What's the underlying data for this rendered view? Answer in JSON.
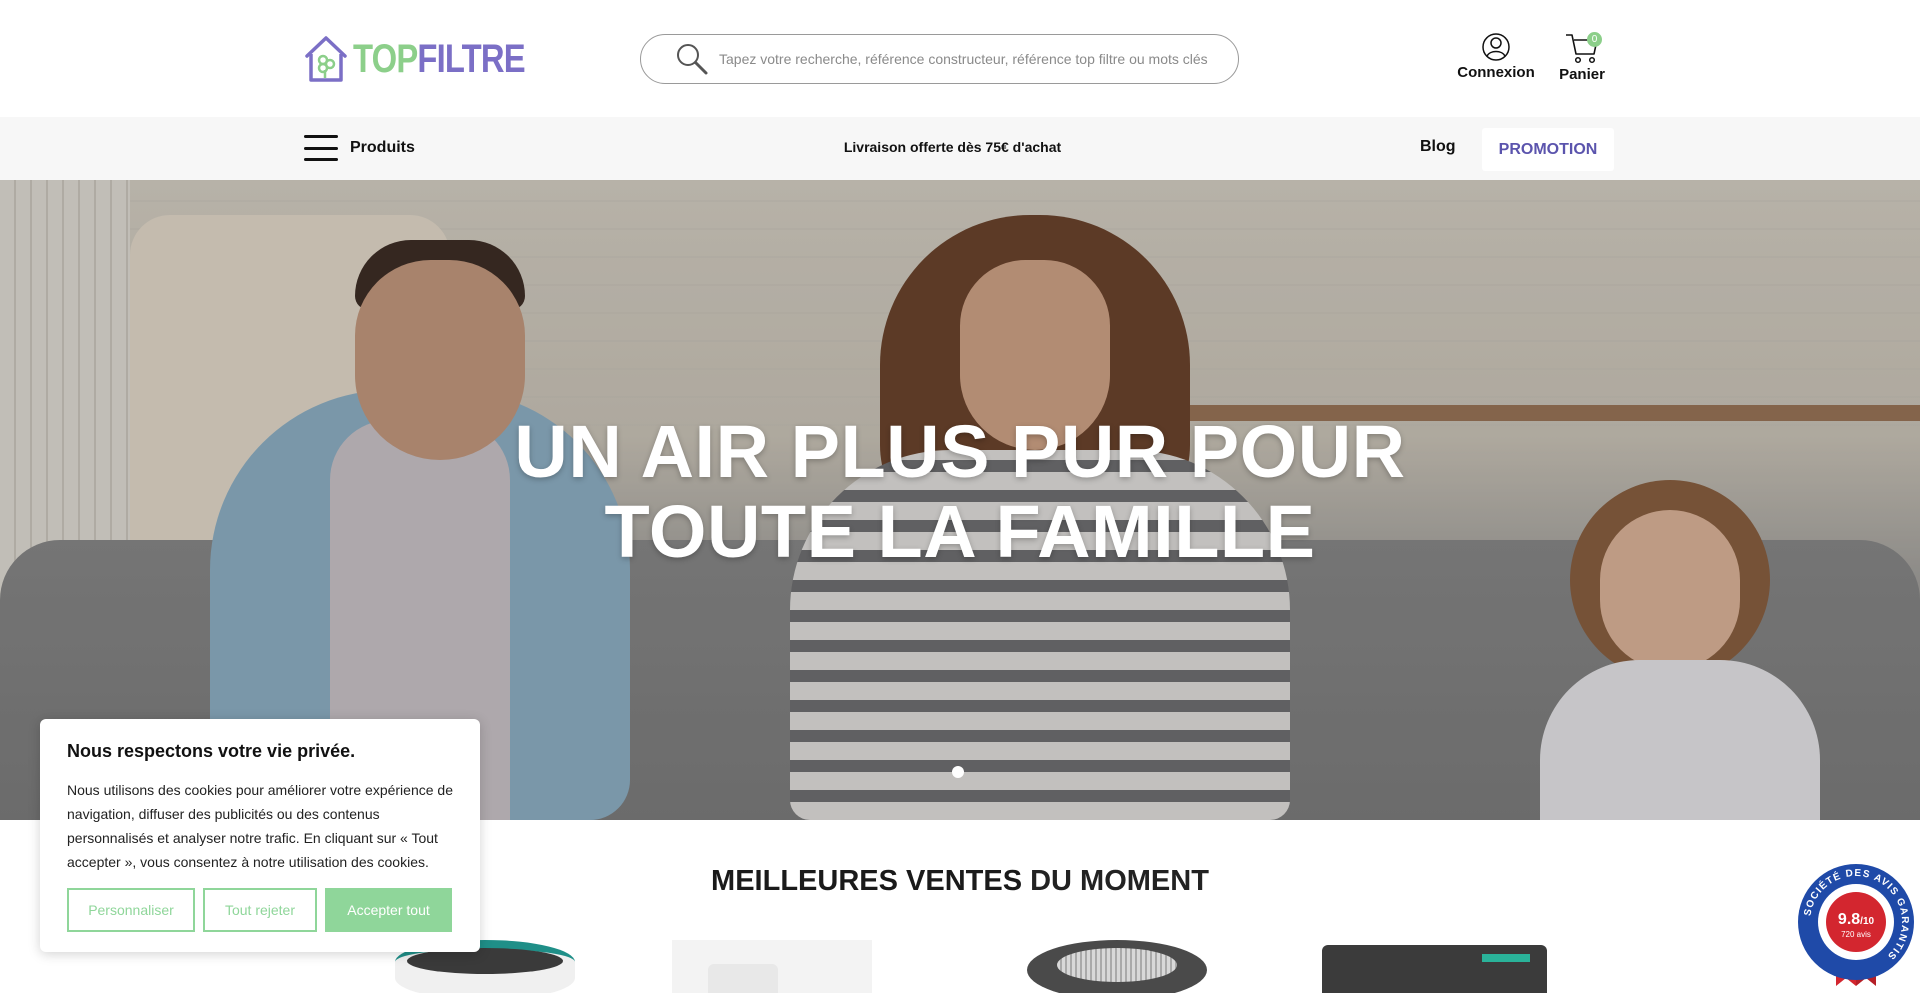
{
  "header": {
    "logo": {
      "part1": "TOP",
      "part2": "FILTRE"
    },
    "search": {
      "placeholder": "Tapez votre recherche, référence constructeur, référence top filtre ou mots clés"
    },
    "account_label": "Connexion",
    "cart_label": "Panier",
    "cart_count": "0"
  },
  "navbar": {
    "menu_label": "Produits",
    "shipping_text": "Livraison offerte dès 75€ d'achat",
    "blog_label": "Blog",
    "promo_label": "PROMOTION"
  },
  "hero": {
    "title_line1": "UN AIR PLUS PUR POUR",
    "title_line2": "TOUTE LA FAMILLE",
    "slides": 1,
    "active_slide": 1
  },
  "bestsellers": {
    "title_bold": "MEILLEURES VENTES",
    "title_rest": "DU MOMENT"
  },
  "cookie": {
    "title": "Nous respectons votre vie privée.",
    "body": "Nous utilisons des cookies pour améliorer votre expérience de navigation, diffuser des publicités ou des contenus personnalisés et analyser notre trafic. En cliquant sur « Tout accepter », vous consentez à notre utilisation des cookies.",
    "personalize_label": "Personnaliser",
    "reject_label": "Tout rejeter",
    "accept_label": "Accepter tout"
  },
  "rating_badge": {
    "ring_text": "SOCIÉTÉ DES AVIS GARANTIS",
    "score": "9.8",
    "scale": "/10",
    "reviews": "720 avis"
  },
  "colors": {
    "logo_green": "#8ccf8a",
    "logo_purple": "#7b6fc6",
    "promo_text": "#5b54ad",
    "cookie_green": "#8fd69a",
    "badge_blue": "#1f4aa8",
    "badge_red": "#d3262f"
  },
  "icons": {
    "logo": "house-leaf-logo-icon",
    "search": "search-icon",
    "account": "user-icon",
    "cart": "cart-icon",
    "menu": "hamburger-icon"
  }
}
